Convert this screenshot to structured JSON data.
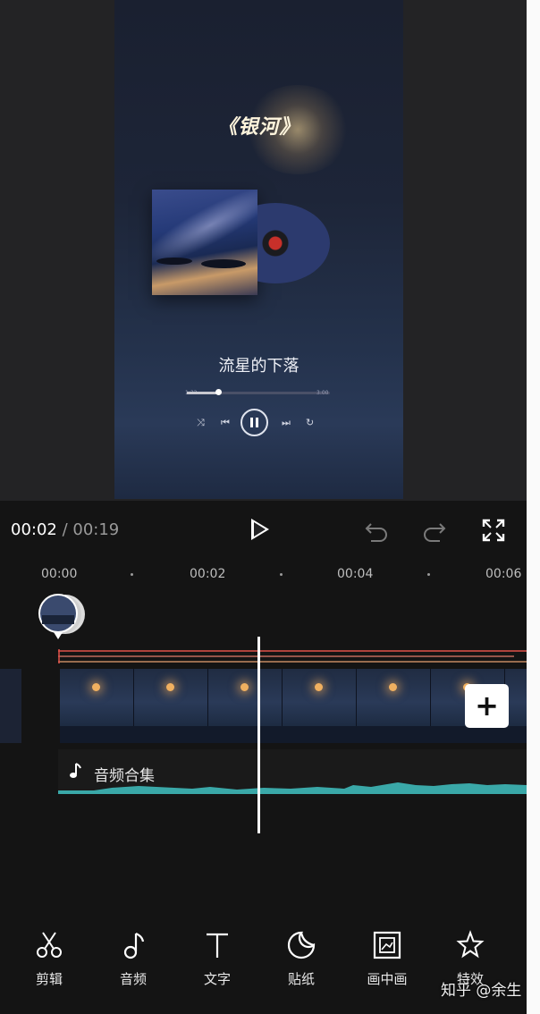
{
  "preview": {
    "song_title": "《银河》",
    "song_name": "流星的下落",
    "player_time_start": "1:32",
    "player_time_end": "3:00",
    "progress_fraction": 0.22
  },
  "playback": {
    "current_time": "00:02",
    "separator": " / ",
    "total_time": "00:19"
  },
  "ruler": {
    "ticks": [
      "00:00",
      "00:02",
      "00:04",
      "00:06"
    ]
  },
  "timeline": {
    "audio_label": "音频合集",
    "add_label": "+"
  },
  "toolbar": {
    "items": [
      {
        "label": "剪辑",
        "icon": "scissors-icon"
      },
      {
        "label": "音频",
        "icon": "music-note-icon"
      },
      {
        "label": "文字",
        "icon": "text-icon"
      },
      {
        "label": "贴纸",
        "icon": "sticker-icon"
      },
      {
        "label": "画中画",
        "icon": "picture-in-picture-icon"
      },
      {
        "label": "特效",
        "icon": "effects-star-icon"
      }
    ]
  },
  "watermark": "知乎 @余生",
  "colors": {
    "background": "#141414",
    "preview_bg": "#232325",
    "timeline_red": "#e0524a",
    "waveform": "#3aa8a8"
  }
}
